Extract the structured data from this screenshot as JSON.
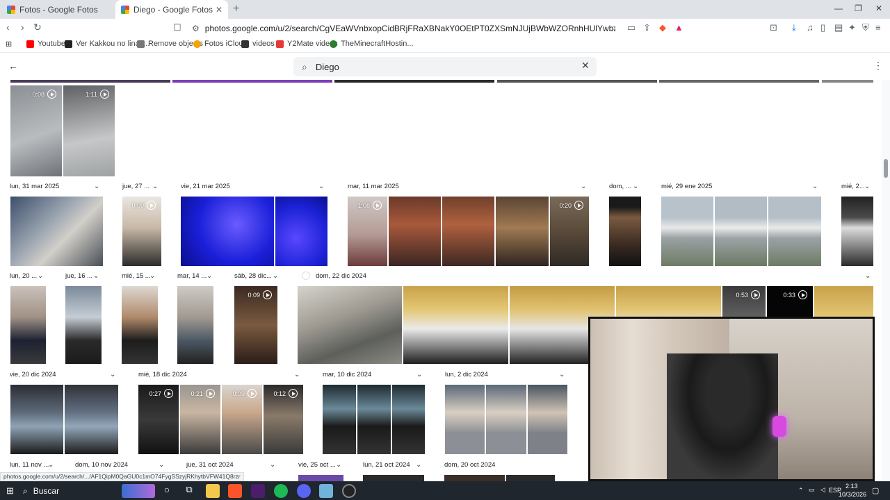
{
  "browser": {
    "tabs": [
      {
        "title": "Fotos - Google Fotos",
        "active": false
      },
      {
        "title": "Diego - Google Fotos",
        "active": true
      }
    ],
    "url": "photos.google.com/u/2/search/CgVEaWVnbxopCidBRjFRaXBNakY0OEtPT0ZXSmNJUjBWbWZORnhHUlYwbzktc2VaMzQiMRIvCi0KKwopEid...",
    "bookmarks": [
      {
        "label": "Youtube",
        "color": "#ff0000"
      },
      {
        "label": "Ver Kakkou no linaz...",
        "color": "#222222"
      },
      {
        "label": "Remove objects",
        "color": "#777777"
      },
      {
        "label": "Fotos iCloud",
        "color": "#f4a300"
      },
      {
        "label": "videos",
        "color": "#333333"
      },
      {
        "label": "Y2Mate videos",
        "color": "#e53935"
      },
      {
        "label": "TheMinecraftHostin...",
        "color": "#2e7d32"
      }
    ],
    "status_url": "photos.google.com/u/2/search/.../AF1QipM0QaGU0c1mO74FygSSzyjRKhytbVFW41Q8rzr"
  },
  "photos": {
    "search_value": "Diego",
    "back_icon": "arrow-left-icon",
    "more_icon": "more-vertical-icon",
    "date_groups": [
      {
        "label": "lun, 31 mar 2025"
      },
      {
        "label": "jue, 27 ..."
      },
      {
        "label": "vie, 21 mar 2025"
      },
      {
        "label": "mar, 11 mar 2025"
      },
      {
        "label": "dom, ..."
      },
      {
        "label": "mié, 29 ene 2025"
      },
      {
        "label": "mié, 2..."
      },
      {
        "label": "lun, 20 ..."
      },
      {
        "label": "jue, 16 ..."
      },
      {
        "label": "mié, 15 ..."
      },
      {
        "label": "mar, 14 ..."
      },
      {
        "label": "sáb, 28 dic..."
      },
      {
        "label": "dom, 22 dic 2024"
      },
      {
        "label": "vie, 20 dic 2024"
      },
      {
        "label": "mié, 18 dic 2024"
      },
      {
        "label": "mar, 10 dic 2024"
      },
      {
        "label": "lun, 2 dic 2024"
      },
      {
        "label": "lun, 11 nov ..."
      },
      {
        "label": "dom, 10 nov 2024"
      },
      {
        "label": "jue, 31 oct 2024"
      },
      {
        "label": "vie, 25 oct ..."
      },
      {
        "label": "lun, 21 oct 2024"
      },
      {
        "label": "dom, 20 oct 2024"
      }
    ],
    "durations": [
      "0:08",
      "1:11",
      "0:09",
      "1:08",
      "0:20",
      "0:09",
      "0:53",
      "0:33",
      "0:27",
      "0:21",
      "0:09",
      "0:12"
    ]
  },
  "taskbar": {
    "search_label": "Buscar",
    "language": "ESP",
    "time": "2:13",
    "date": "10/3/2026"
  }
}
